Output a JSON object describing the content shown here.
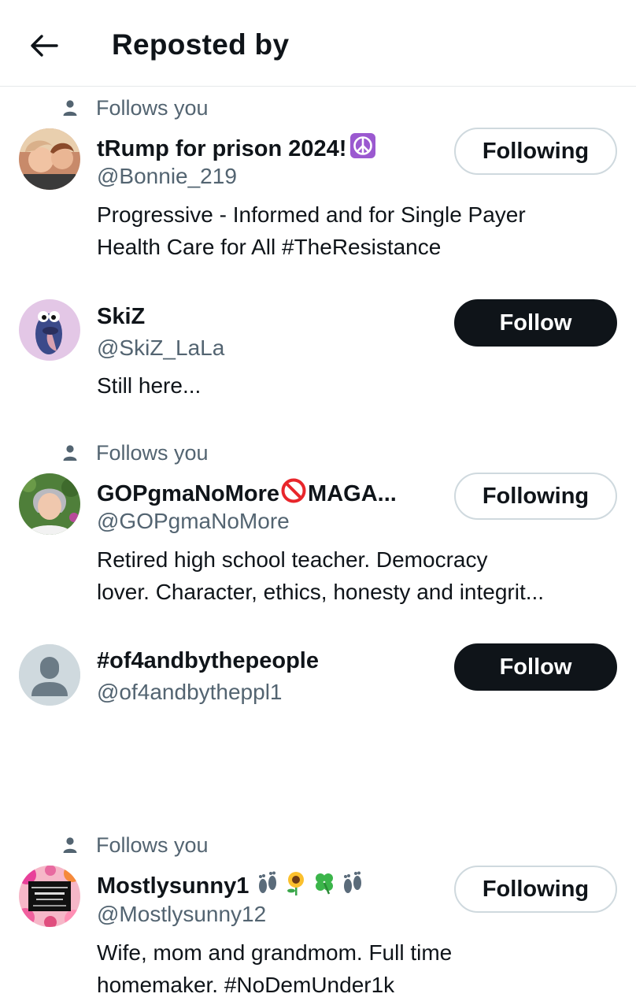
{
  "header": {
    "title": "Reposted by",
    "back_icon": "arrow-left-icon"
  },
  "follows_you_label": "Follows you",
  "colors": {
    "text_primary": "#0f1419",
    "text_secondary": "#536471",
    "follow_button_bg": "#0f1419",
    "following_border": "#cfd9de"
  },
  "users": [
    {
      "follows_you": true,
      "name": "tRump for prison 2024!",
      "name_emoji": "peace-symbol",
      "handle": "@Bonnie_219",
      "bio": "Progressive - Informed and for Single Payer\nHealth Care for All #TheResistance",
      "button": "Following"
    },
    {
      "follows_you": false,
      "name": "SkiZ",
      "handle": "@SkiZ_LaLa",
      "bio": "Still here...",
      "button": "Follow"
    },
    {
      "follows_you": true,
      "name": "GOPgmaNoMore",
      "name_emoji": "prohibited-sign",
      "name_suffix": "MAGA...",
      "handle": "@GOPgmaNoMore",
      "bio": "Retired high school teacher. Democracy\nlover. Character, ethics, honesty and integrit...",
      "button": "Following"
    },
    {
      "follows_you": false,
      "name": "#of4andbythepeople",
      "handle": "@of4andbytheppl1",
      "bio": "",
      "button": "Follow"
    },
    {
      "follows_you": true,
      "name": "Mostlysunny1",
      "name_emoji": "footprints sunflower four-leaf-clover footprints",
      "handle": "@Mostlysunny12",
      "bio": "Wife, mom and grandmom. Full time\nhomemaker.   #NoDemUnder1k",
      "button": "Following"
    }
  ]
}
